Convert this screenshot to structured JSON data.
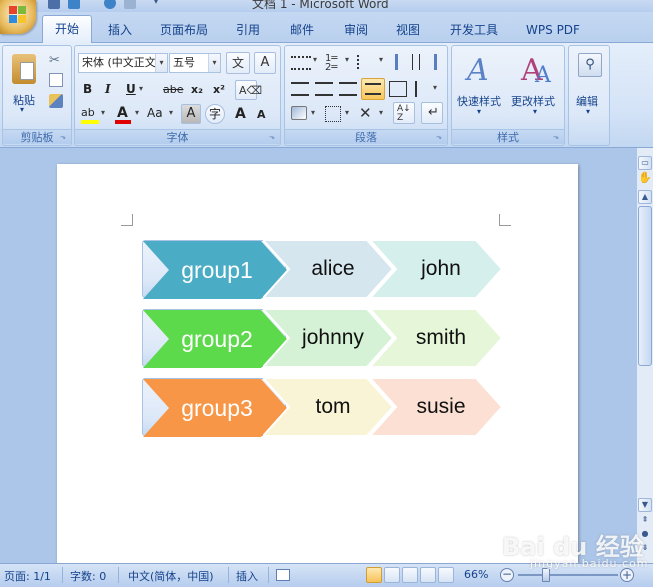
{
  "window": {
    "title": "文档 1 - Microsoft Word"
  },
  "tabs": [
    {
      "label": "开始",
      "active": true
    },
    {
      "label": "插入"
    },
    {
      "label": "页面布局"
    },
    {
      "label": "引用"
    },
    {
      "label": "邮件"
    },
    {
      "label": "审阅"
    },
    {
      "label": "视图"
    },
    {
      "label": "开发工具"
    },
    {
      "label": "WPS PDF"
    }
  ],
  "ribbon": {
    "clipboard": {
      "group_label": "剪贴板",
      "paste_label": "粘贴"
    },
    "font": {
      "group_label": "字体",
      "font_name": "宋体 (中文正文",
      "font_size": "五号",
      "bold": "B",
      "italic": "I",
      "underline": "U",
      "strike": "abe",
      "subscript": "x₂",
      "superscript": "x²",
      "change_case": "Aa",
      "grow": "A",
      "shrink": "A",
      "char_border": "A",
      "char_shading": "A",
      "enclose": "字",
      "phonetic": "wén",
      "phonetic_char": "文"
    },
    "paragraph": {
      "group_label": "段落"
    },
    "styles": {
      "group_label": "样式",
      "quick_styles_label": "快速样式",
      "change_styles_label": "更改样式"
    },
    "editing": {
      "editing_label": "编辑"
    }
  },
  "document": {
    "rows": [
      {
        "group": "group1",
        "members": [
          "alice",
          "john"
        ]
      },
      {
        "group": "group2",
        "members": [
          "johnny",
          "smith"
        ]
      },
      {
        "group": "group3",
        "members": [
          "tom",
          "susie"
        ]
      }
    ]
  },
  "colors": {
    "group1": "#4bacc6",
    "group1_light1": "#d6e6ef",
    "group1_light2": "#d5efec",
    "group2": "#5dd94c",
    "group2_light1": "#d6f2d6",
    "group2_light2": "#e5f6d9",
    "group3": "#f79646",
    "group3_light1": "#faf4d6",
    "group3_light2": "#fbe0d3"
  },
  "statusbar": {
    "page": "页面: 1/1",
    "words": "字数: 0",
    "language": "中文(简体，中国)",
    "mode": "插入",
    "zoom": "66%"
  },
  "watermark": {
    "text": "Bai du 经验",
    "sub": "jingyan.baidu.com"
  }
}
